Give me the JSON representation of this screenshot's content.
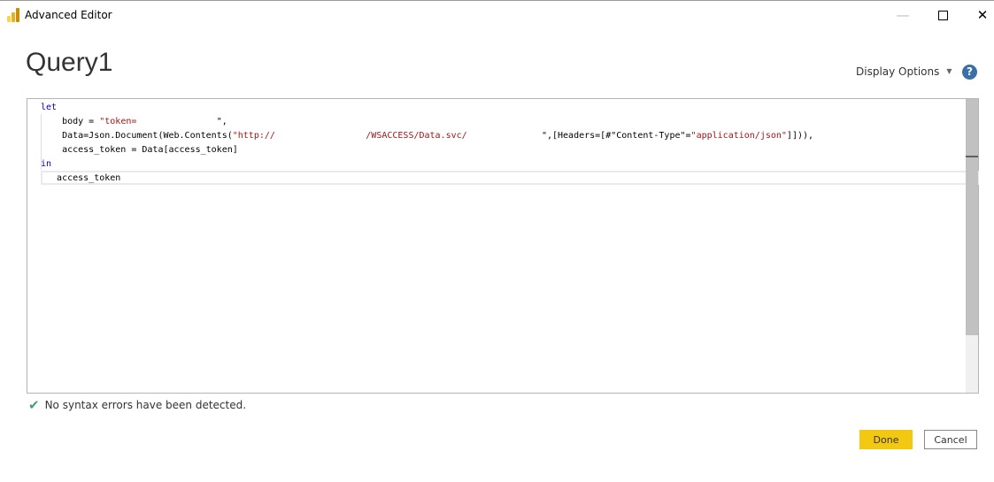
{
  "window": {
    "title": "Advanced Editor",
    "minimize_icon": "minimize-icon",
    "maximize_icon": "maximize-icon",
    "close_icon": "close-icon"
  },
  "query": {
    "title": "Query1"
  },
  "toolbar": {
    "display_options_label": "Display Options",
    "help_icon": "help-icon"
  },
  "editor": {
    "lines": [
      {
        "text": "let"
      },
      {
        "t1": "    body = ",
        "s1": "\"token=",
        "t2": "               \","
      },
      {
        "t1": "    Data=Json.Document(Web.Contents(",
        "s1": "\"http://",
        "t2": "                 ",
        "s2": "/WSACCESS/Data.svc/",
        "t3": "              \",[Headers=[#\"Content-Type\"=",
        "s3": "\"application/json\"",
        "t4": "]])),"
      },
      {
        "text": "    access_token = Data[access_token]"
      },
      {
        "text": "in"
      },
      {
        "text": "   access_token"
      }
    ]
  },
  "status": {
    "message": "No syntax errors have been detected.",
    "icon": "checkmark-icon",
    "color": "#4a9b7a"
  },
  "buttons": {
    "done": "Done",
    "cancel": "Cancel"
  },
  "colors": {
    "accent": "#f2c811",
    "keyword": "#0000c8",
    "string": "#a31515"
  }
}
